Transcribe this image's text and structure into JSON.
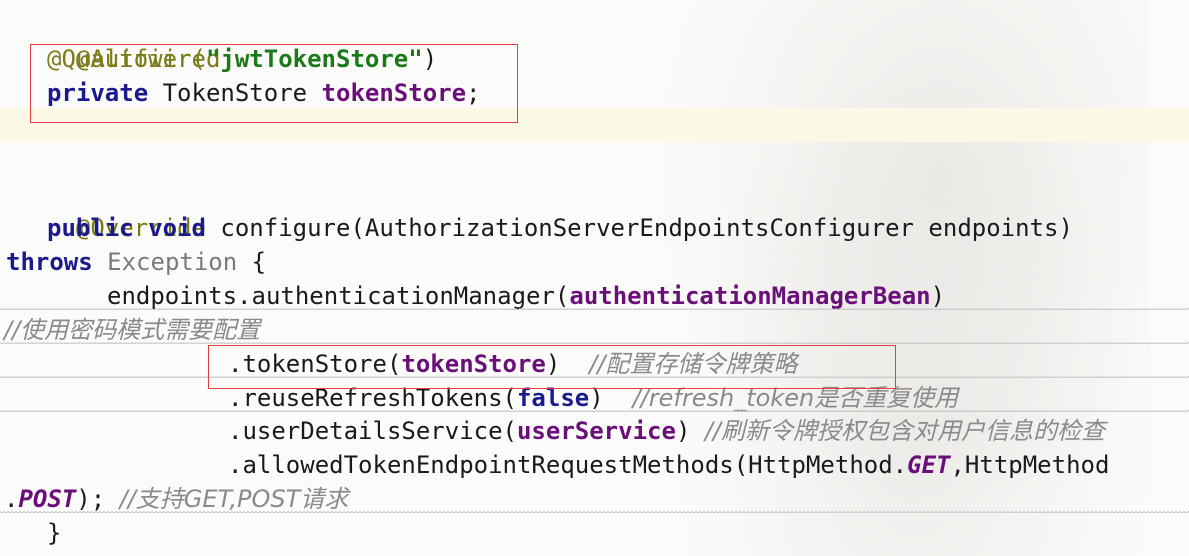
{
  "code": {
    "l1_annotation": "@Autowired",
    "l2_annotation": "@Qualifier(",
    "l2_string": "\"jwtTokenStore\"",
    "l2_close": ")",
    "l3_private": "private",
    "l3_type": " TokenStore ",
    "l3_field": "tokenStore",
    "l3_semicolon": ";",
    "l5_annotation": "@Override",
    "l6_public": "public",
    "l6_void": "void",
    "l6_rest": " configure(AuthorizationServerEndpointsConfigurer endpoints)",
    "l7_throws": "throws",
    "l7_exception": "Exception",
    "l7_brace": " {",
    "l8_prefix": "endpoints.authenticationManager(",
    "l8_field": "authenticationManagerBean",
    "l8_close": ")",
    "l9_comment": "//使用密码模式需要配置",
    "l10_prefix": ".tokenStore(",
    "l10_field": "tokenStore",
    "l10_close": ")  ",
    "l10_comment": "//配置存储令牌策略",
    "l11_prefix": ".reuseRefreshTokens(",
    "l11_kw": "false",
    "l11_close": ")  ",
    "l11_comment": "//refresh_token是否重复使用",
    "l12_prefix": ".userDetailsService(",
    "l12_field": "userService",
    "l12_close": ") ",
    "l12_comment": "//刷新令牌授权包含对用户信息的检查",
    "l13_prefix": ".allowedTokenEndpointRequestMethods(HttpMethod.",
    "l13_const": "GET",
    "l13_rest": ",HttpMethod",
    "l14_prefix": ".",
    "l14_const": "POST",
    "l14_close": "); ",
    "l14_comment": "//支持GET,POST请求",
    "l15_brace": "}"
  },
  "colors": {
    "annotation": "#7b7b18",
    "keyword": "#1a1a8f",
    "string": "#1a7a1a",
    "field": "#6a0f7a",
    "comment": "#8a8a8a",
    "highlight_box": "#e0403f",
    "caret_line": "#fbf8e6"
  }
}
